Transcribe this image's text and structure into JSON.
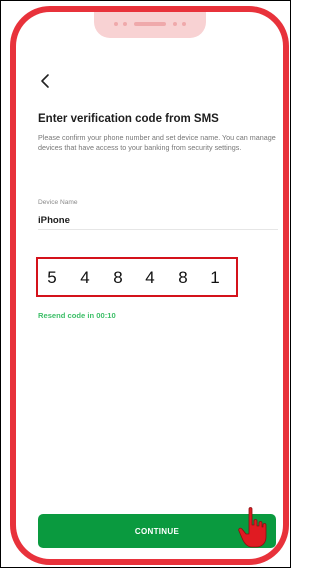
{
  "header": {
    "back_icon": "chevron-left-icon"
  },
  "verification": {
    "title": "Enter verification code from SMS",
    "description": "Please confirm your phone number and set device name. You can manage devices that have access to your banking from security settings."
  },
  "device": {
    "label": "Device Name",
    "value": "iPhone"
  },
  "code": {
    "digits": [
      "5",
      "4",
      "8",
      "4",
      "8",
      "1"
    ]
  },
  "resend": {
    "text": "Resend code in",
    "timer": "00:10"
  },
  "footer": {
    "continue_label": "CONTINUE",
    "cursor_icon": "hand-pointer-icon"
  },
  "colors": {
    "phone_frame": "#e8323b",
    "highlight": "#d4121b",
    "accent_green": "#0a9a3f",
    "resend_green": "#3dbf68"
  }
}
